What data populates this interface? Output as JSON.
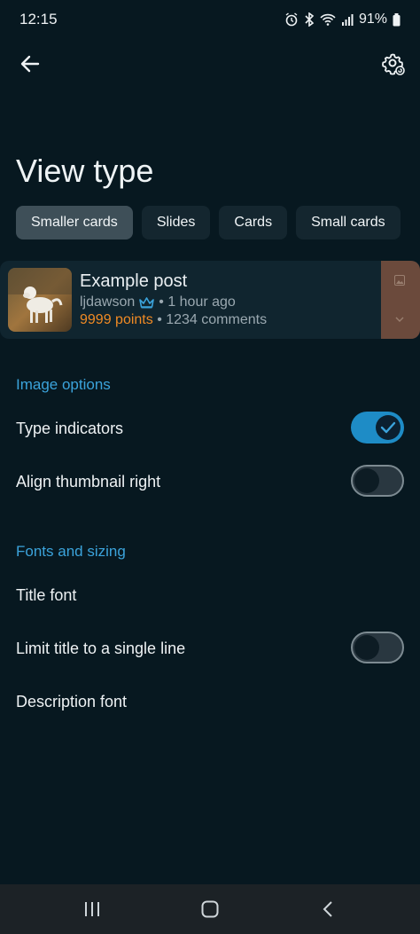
{
  "status": {
    "time": "12:15",
    "battery": "91%",
    "icons": [
      "alarm-icon",
      "bluetooth-icon",
      "wifi-icon",
      "signal-icon",
      "battery-icon"
    ]
  },
  "header": {
    "back_icon": "back-arrow-icon",
    "settings_icon": "gear-icon"
  },
  "page": {
    "title": "View type"
  },
  "view_types": [
    {
      "label": "Smaller cards",
      "selected": true
    },
    {
      "label": "Slides",
      "selected": false
    },
    {
      "label": "Cards",
      "selected": false
    },
    {
      "label": "Small cards",
      "selected": false
    }
  ],
  "preview": {
    "title": "Example post",
    "author": "ljdawson",
    "time": "• 1 hour ago",
    "points": "9999 points",
    "comments": "• 1234 comments",
    "badge_icon": "crown-icon"
  },
  "image_options": {
    "header": "Image options",
    "type_indicators": {
      "label": "Type indicators",
      "on": true
    },
    "align_thumbnail": {
      "label": "Align thumbnail right",
      "on": false
    }
  },
  "fonts": {
    "header": "Fonts and sizing",
    "title_font": "Title font",
    "single_line": {
      "label": "Limit title to a single line",
      "on": false
    },
    "description_font": "Description font"
  },
  "colors": {
    "background": "#071820",
    "accent": "#3ba3db",
    "points": "#f08a24",
    "toggle_on": "#1e8cc6"
  }
}
